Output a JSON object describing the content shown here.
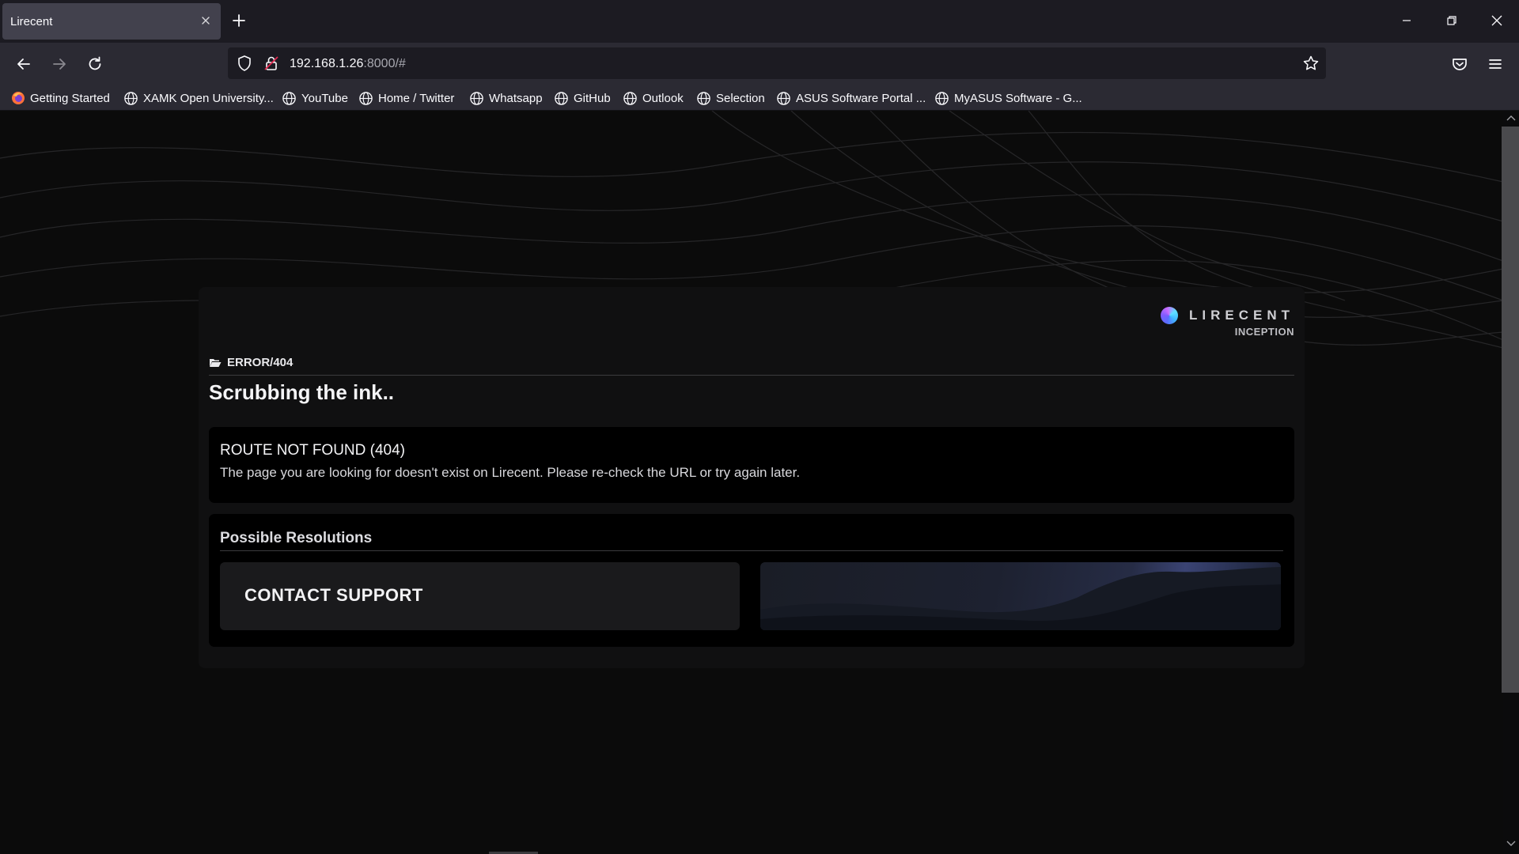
{
  "browser": {
    "tab_title": "Lirecent",
    "url_host": "192.168.1.26",
    "url_rest": ":8000/#",
    "bookmarks": [
      {
        "label": "Getting Started",
        "icon": "firefox-icon"
      },
      {
        "label": "XAMK Open University...",
        "icon": "globe-icon"
      },
      {
        "label": "YouTube",
        "icon": "globe-icon"
      },
      {
        "label": "Home / Twitter",
        "icon": "globe-icon"
      },
      {
        "label": "Whatsapp",
        "icon": "globe-icon"
      },
      {
        "label": "GitHub",
        "icon": "globe-icon"
      },
      {
        "label": "Outlook",
        "icon": "globe-icon"
      },
      {
        "label": "Selection",
        "icon": "globe-icon"
      },
      {
        "label": "ASUS Software Portal ...",
        "icon": "globe-icon"
      },
      {
        "label": "MyASUS Software - G...",
        "icon": "globe-icon"
      }
    ]
  },
  "page": {
    "brand_name": "LIRECENT",
    "brand_sub": "INCEPTION",
    "crumb": "ERROR/404",
    "title": "Scrubbing the ink..",
    "error": {
      "title": "ROUTE NOT FOUND (404)",
      "message": "The page you are looking for doesn't exist on Lirecent. Please re-check the URL or try again later."
    },
    "resolutions": {
      "title": "Possible Resolutions",
      "contact_label": "CONTACT SUPPORT"
    }
  },
  "colors": {
    "chrome_dark": "#1c1b22",
    "chrome": "#2b2a33",
    "tab_active": "#42414d",
    "page_bg": "#0b0b0b",
    "card_bg": "#000000",
    "button_bg": "#1a1a1c"
  }
}
